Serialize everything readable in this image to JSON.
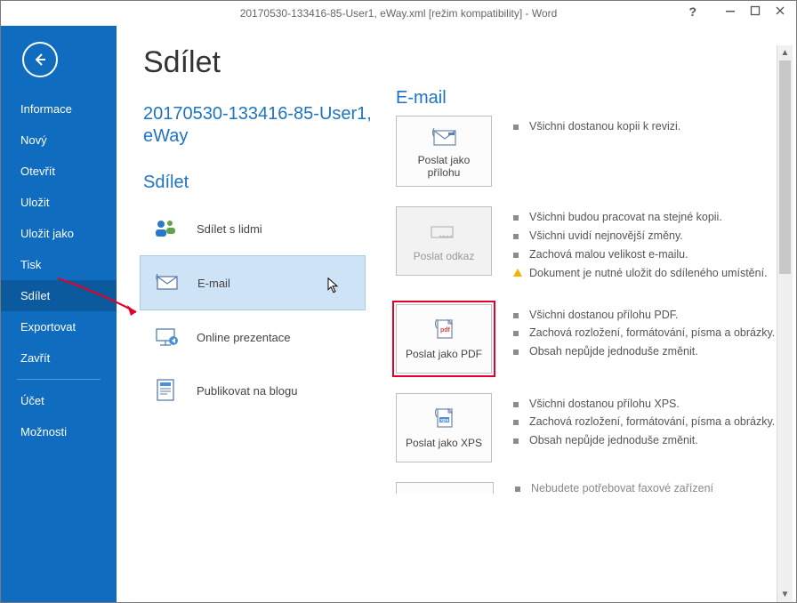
{
  "titlebar": {
    "text": "20170530-133416-85-User1, eWay.xml [režim kompatibility] - Word"
  },
  "sidebar": {
    "items": [
      {
        "label": "Informace"
      },
      {
        "label": "Nový"
      },
      {
        "label": "Otevřít"
      },
      {
        "label": "Uložit"
      },
      {
        "label": "Uložit jako"
      },
      {
        "label": "Tisk"
      },
      {
        "label": "Sdílet",
        "active": true
      },
      {
        "label": "Exportovat"
      },
      {
        "label": "Zavřít"
      }
    ],
    "footer": [
      {
        "label": "Účet"
      },
      {
        "label": "Možnosti"
      }
    ]
  },
  "page": {
    "title": "Sdílet",
    "docname": "20170530-133416-85-User1, eWay",
    "share_heading": "Sdílet",
    "options": [
      {
        "label": "Sdílet s lidmi",
        "icon": "people"
      },
      {
        "label": "E-mail",
        "icon": "mail",
        "selected": true
      },
      {
        "label": "Online prezentace",
        "icon": "present"
      },
      {
        "label": "Publikovat na blogu",
        "icon": "blog"
      }
    ]
  },
  "email": {
    "heading": "E-mail",
    "cards": [
      {
        "label": "Poslat jako přílohu",
        "icon": "attach",
        "bullets": [
          "Všichni dostanou kopii k revizi."
        ]
      },
      {
        "label": "Poslat odkaz",
        "icon": "link",
        "disabled": true,
        "bullets": [
          "Všichni budou pracovat na stejné kopii.",
          "Všichni uvidí nejnovější změny.",
          "Zachová malou velikost e-mailu."
        ],
        "warn": "Dokument je nutné uložit do sdíleného umístění."
      },
      {
        "label": "Poslat jako PDF",
        "icon": "pdf",
        "highlight": true,
        "bullets": [
          "Všichni dostanou přílohu PDF.",
          "Zachová rozložení, formátování, písma a obrázky.",
          "Obsah nepůjde jednoduše změnit."
        ]
      },
      {
        "label": "Poslat jako XPS",
        "icon": "xps",
        "bullets": [
          "Všichni dostanou přílohu XPS.",
          "Zachová rozložení, formátování, písma a obrázky.",
          "Obsah nepůjde jednoduše změnit."
        ]
      }
    ],
    "cutoff": "Nebudete potřebovat faxové zařízení"
  }
}
